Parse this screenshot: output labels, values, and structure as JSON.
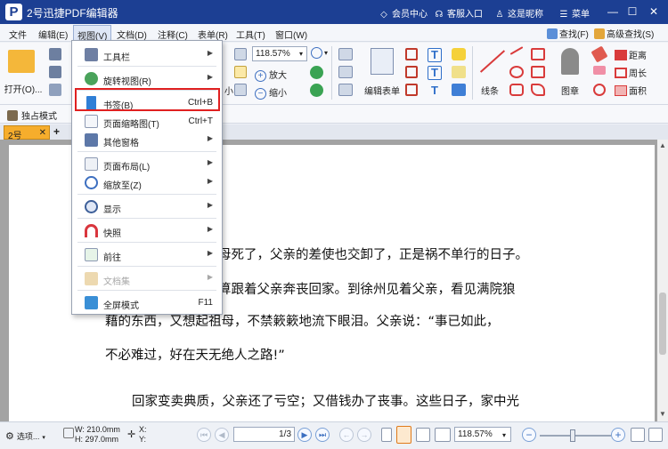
{
  "app": {
    "title": "2号迅捷PDF编辑器",
    "icon_letter": "P",
    "member_center": "会员中心",
    "customer_service": "客服入口",
    "nickname": "这是昵称",
    "menu": "菜单"
  },
  "menubar": {
    "items": [
      "文件",
      "编辑(E)",
      "视图(V)",
      "文档(D)",
      "注释(C)",
      "表单(R)",
      "工具(T)",
      "窗口(W)"
    ],
    "find": "查找(F)",
    "advanced_find": "高级查找(S)"
  },
  "ribbon": {
    "open": "打开(O)...",
    "zoom_value": "118.57%",
    "zoom_in": "放大",
    "zoom_out": "缩小",
    "edit_form": "编辑表单",
    "lines": "线条",
    "stamp": "图章",
    "distance": "距离",
    "perimeter": "周长",
    "area": "面积"
  },
  "toolstrip": {
    "exclusive_mode": "独占模式"
  },
  "tabs": {
    "doc_tab": "2号"
  },
  "view_menu": [
    {
      "label": "工具栏",
      "shortcut": "",
      "sub": true
    },
    {
      "label": "旋转视图(R)",
      "shortcut": "",
      "sub": true
    },
    {
      "label": "书签(B)",
      "shortcut": "Ctrl+B",
      "sub": false
    },
    {
      "label": "页面缩略图(T)",
      "shortcut": "Ctrl+T",
      "sub": false
    },
    {
      "label": "其他窗格",
      "shortcut": "",
      "sub": true
    },
    {
      "label": "页面布局(L)",
      "shortcut": "",
      "sub": true
    },
    {
      "label": "缩放至(Z)",
      "shortcut": "",
      "sub": true
    },
    {
      "label": "显示",
      "shortcut": "",
      "sub": true
    },
    {
      "label": "快照",
      "shortcut": "",
      "sub": true
    },
    {
      "label": "前往",
      "shortcut": "",
      "sub": true
    },
    {
      "label": "文档集",
      "shortcut": "",
      "sub": true,
      "disabled": true
    },
    {
      "label": "全屏模式",
      "shortcut": "F11",
      "sub": false
    }
  ],
  "document": {
    "lines": [
      "母死了，父亲的差使也交卸了，正是祸不单行的日子。",
      "算跟着父亲奔丧回家。到徐州见着父亲，看见满院狼",
      "藉的东西，又想起祖母，不禁簌簌地流下眼泪。父亲说：“事已如此，",
      "不必难过，好在天无绝人之路!”",
      "回家变卖典质，父亲还了亏空；又借钱办了丧事。这些日子，家中光"
    ]
  },
  "status": {
    "options": "选项...",
    "width": "W: 210.0mm",
    "height": "H: 297.0mm",
    "x": "X:",
    "y": "Y:",
    "page_current": "1",
    "page_total": "3",
    "zoom": "118.57%"
  },
  "colors": {
    "title_bar": "#1c3f93",
    "highlight": "#e02020",
    "page_tab": "#f6ad2c"
  }
}
